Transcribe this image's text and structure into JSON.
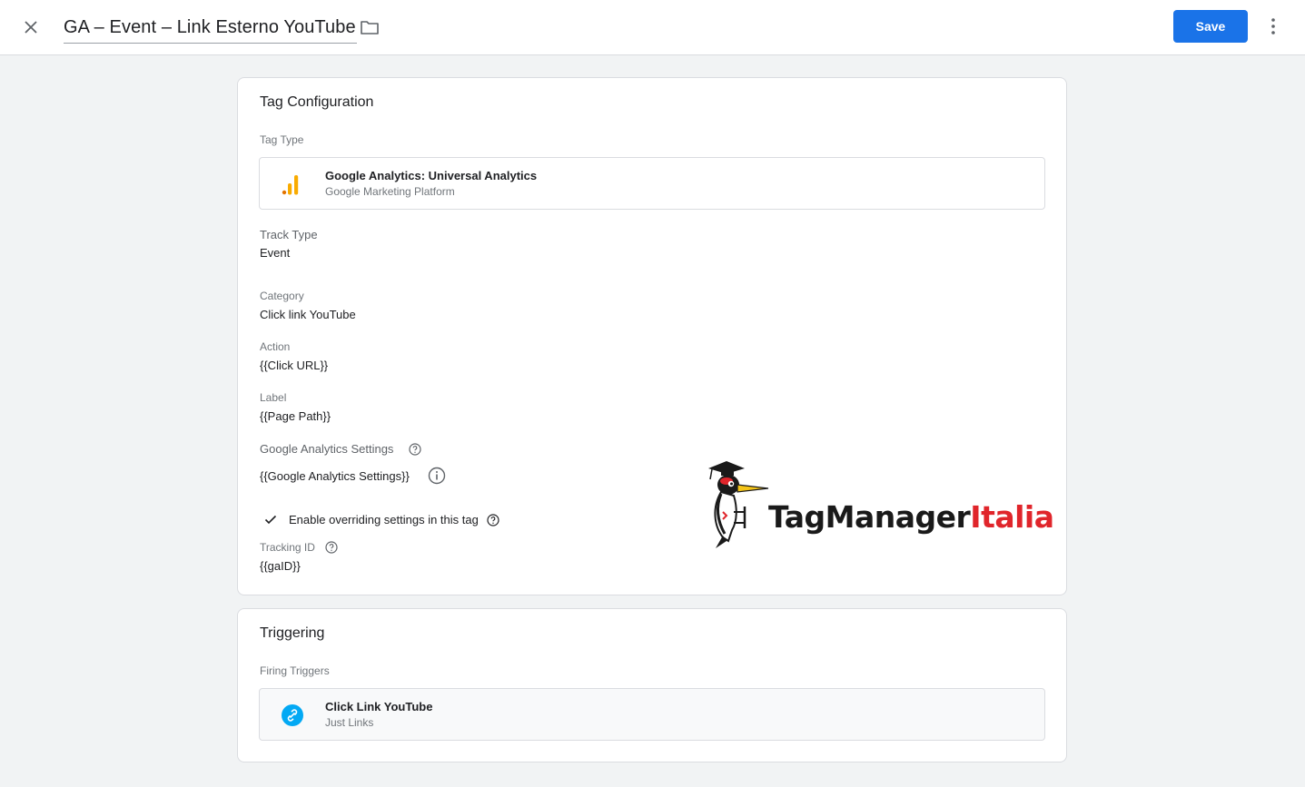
{
  "header": {
    "title": "GA – Event – Link Esterno YouTube",
    "save_label": "Save",
    "icons": {
      "close": "close-icon",
      "folder": "folder-icon",
      "more": "more-vert-icon"
    }
  },
  "tag_config": {
    "heading": "Tag Configuration",
    "tag_type_label": "Tag Type",
    "tag_type": {
      "name": "Google Analytics: Universal Analytics",
      "provider": "Google Marketing Platform",
      "icon": "google-analytics-icon"
    },
    "track_type_label": "Track Type",
    "track_type_value": "Event",
    "category_label": "Category",
    "category_value": "Click link YouTube",
    "action_label": "Action",
    "action_value": "{{Click URL}}",
    "label_label": "Label",
    "label_value": "{{Page Path}}",
    "ga_settings_label": "Google Analytics Settings",
    "ga_settings_value": "{{Google Analytics Settings}}",
    "override_label": "Enable overriding settings in this tag",
    "override_checked": true,
    "tracking_id_label": "Tracking ID",
    "tracking_id_value": "{{gaID}}"
  },
  "triggering": {
    "heading": "Triggering",
    "firing_label": "Firing Triggers",
    "trigger": {
      "name": "Click Link YouTube",
      "type": "Just Links",
      "icon": "link-icon"
    }
  },
  "watermark": {
    "brand_black": "TagManager",
    "brand_red": "Italia"
  },
  "colors": {
    "primary": "#1a73e8",
    "ga_orange": "#f9ab00",
    "ga_dark_orange": "#e37400",
    "link_blue": "#03a9f4",
    "brand_red": "#e0252b"
  }
}
